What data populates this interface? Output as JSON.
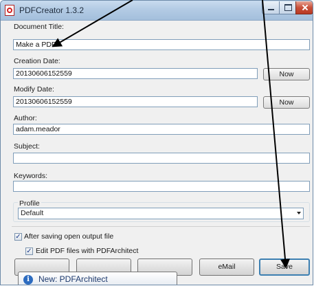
{
  "window": {
    "title": "PDFCreator 1.3.2"
  },
  "document_title": {
    "label": "Document Title:",
    "value": "Make a PDF"
  },
  "creation_date": {
    "label": "Creation Date:",
    "value": "20130606152559",
    "now_label": "Now"
  },
  "modify_date": {
    "label": "Modify Date:",
    "value": "20130606152559",
    "now_label": "Now"
  },
  "author": {
    "label": "Author:",
    "value": "adam.meador"
  },
  "subject": {
    "label": "Subject:",
    "value": ""
  },
  "keywords": {
    "label": "Keywords:",
    "value": ""
  },
  "profile": {
    "label": "Profile",
    "selected": "Default"
  },
  "options": {
    "open_after_saving": {
      "label": "After saving open output file",
      "checked": true
    },
    "edit_with_architect": {
      "label": "Edit PDF files with PDFArchitect",
      "checked": true
    }
  },
  "buttons": {
    "email_label": "eMail",
    "save_label": "Save"
  },
  "tooltip": {
    "text": "New: PDFArchitect"
  },
  "icons": {
    "app": "pdfcreator-icon",
    "minimize": "minimize-icon",
    "maximize": "maximize-icon",
    "close": "close-icon",
    "info": "info-icon",
    "dropdown": "chevron-down-icon"
  },
  "colors": {
    "annotation_arrow": "#000000",
    "title_bar": "#b3cbe4",
    "close_button": "#c8503a"
  }
}
